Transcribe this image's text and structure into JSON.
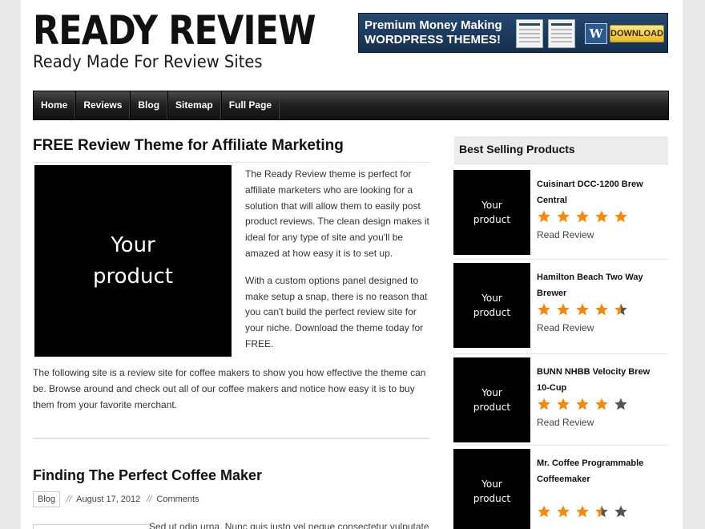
{
  "header": {
    "logo_title": "READY REVIEW",
    "logo_tagline": "Ready Made For Review Sites",
    "banner": {
      "line1": "Premium Money Making",
      "line2": "WORDPRESS THEMES!",
      "wp_glyph": "W",
      "download_label": "DOWNLOAD"
    }
  },
  "nav": {
    "items": [
      "Home",
      "Reviews",
      "Blog",
      "Sitemap",
      "Full Page"
    ]
  },
  "main": {
    "post1": {
      "title": "FREE Review Theme for Affiliate Marketing",
      "image_placeholder": "Your\nproduct",
      "paragraph1": "The Ready Review theme is perfect for affiliate marketers who are looking for a solution that will allow them to easily post product reviews. The clean design makes it ideal for any type of site and you'll be amazed at how easy it is to set up.",
      "paragraph2": "With a custom options panel designed to make setup a snap, there is no reason that you can't build the perfect review site for your niche. Download the theme today for FREE.",
      "paragraph3": "The following site is a review site for coffee makers to show you how effective the theme can be. Browse around and check out all of our coffee makers and notice how easy it is to buy them from your favorite merchant."
    },
    "post2": {
      "title": "Finding The Perfect Coffee Maker",
      "category": "Blog",
      "separator": "//",
      "date": "August 17, 2012",
      "comments": "Comments",
      "excerpt": "Sed ut odio urna. Nunc quis justo vel neque consectetur vulputate"
    }
  },
  "sidebar": {
    "heading": "Best Selling Products",
    "read_review_label": "Read Review",
    "thumb_placeholder": "Your\nproduct",
    "star_color": "#f08a12",
    "star_empty_color": "#555555",
    "products": [
      {
        "name": "Cuisinart DCC-1200 Brew Central",
        "rating": 5
      },
      {
        "name": "Hamilton Beach Two Way Brewer",
        "rating": 4.5
      },
      {
        "name": "BUNN NHBB Velocity Brew 10-Cup",
        "rating": 4
      },
      {
        "name": "Mr. Coffee Programmable Coffeemaker",
        "rating": 3.5
      }
    ]
  }
}
